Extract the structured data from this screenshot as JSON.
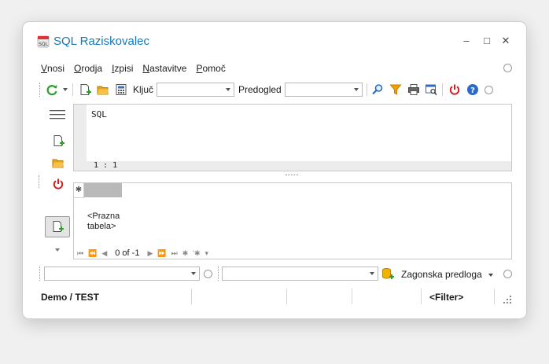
{
  "window": {
    "title": "SQL Raziskovalec",
    "controls": {
      "minimize": "–",
      "maximize": "□",
      "close": "✕"
    }
  },
  "menu": {
    "items": [
      "Vnosi",
      "Orodja",
      "Izpisi",
      "Nastavitve",
      "Pomoč"
    ]
  },
  "toolbar": {
    "key_label": "Ključ",
    "key_value": "",
    "preview_label": "Predogled",
    "preview_value": ""
  },
  "editor": {
    "text": "SQL",
    "cursor_position": "1 : 1"
  },
  "grid": {
    "corner_symbol": "✱",
    "empty_text": "<Prazna\ntabela>",
    "empty_line1": "<Prazna",
    "empty_line2": "tabela>",
    "navigator": {
      "record_count": "0 of -1",
      "buttons": [
        "⏮",
        "⏪",
        "◀",
        "▶",
        "⏩",
        "⏭",
        "✱",
        "'✱",
        "▾"
      ]
    }
  },
  "bottom_bar": {
    "combo1_value": "",
    "combo2_value": "",
    "template_label": "Zagonska predloga"
  },
  "statusbar": {
    "connection": "Demo / TEST",
    "filter": "<Filter>"
  },
  "colors": {
    "title_blue": "#1478b8",
    "power_red": "#cc2222",
    "help_blue": "#2a6bc9",
    "refresh_green": "#2aa02a",
    "funnel_orange": "#f0a000"
  }
}
